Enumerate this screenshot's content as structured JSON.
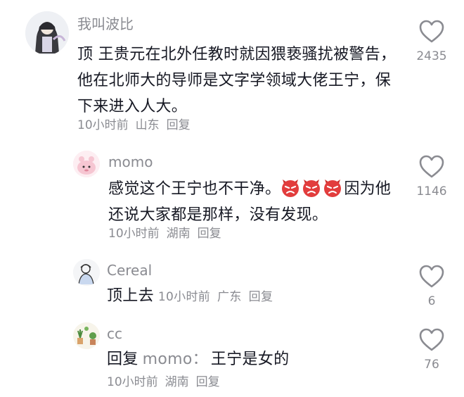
{
  "comments": [
    {
      "username": "我叫波比",
      "content": "顶 王贵元在北外任教时就因猥亵骚扰被警告，他在北师大的导师是文字学领域大佬王宁，保下来进入人大。",
      "time": "10小时前",
      "location": "山东",
      "reply_label": "回复",
      "likes": "2435",
      "avatar_icon": "avatar-illustrated-figure"
    },
    {
      "username": "momo",
      "content_before": "感觉这个王宁也不干净。",
      "emoji_icon": "angry-devil-emoji",
      "emoji_count": 3,
      "content_after": "因为他还说大家都是那样，没有发现。",
      "time": "10小时前",
      "location": "湖南",
      "reply_label": "回复",
      "likes": "1146",
      "avatar_icon": "avatar-pink-character"
    },
    {
      "username": "Cereal",
      "content": "顶上去",
      "time": "10小时前",
      "location": "广东",
      "reply_label": "回复",
      "likes": "6",
      "avatar_icon": "avatar-sketch-figure"
    },
    {
      "username": "cc",
      "reply_prefix": "回复",
      "reply_target": "momo：",
      "content": "王宁是女的",
      "time": "10小时前",
      "location": "湖南",
      "reply_label": "回复",
      "likes": "76",
      "avatar_icon": "avatar-plants"
    }
  ],
  "colors": {
    "text_primary": "#161823",
    "text_secondary": "#8a8b91",
    "emoji_red": "#e23d3d"
  },
  "icons": {
    "like": "heart-outline-icon"
  }
}
